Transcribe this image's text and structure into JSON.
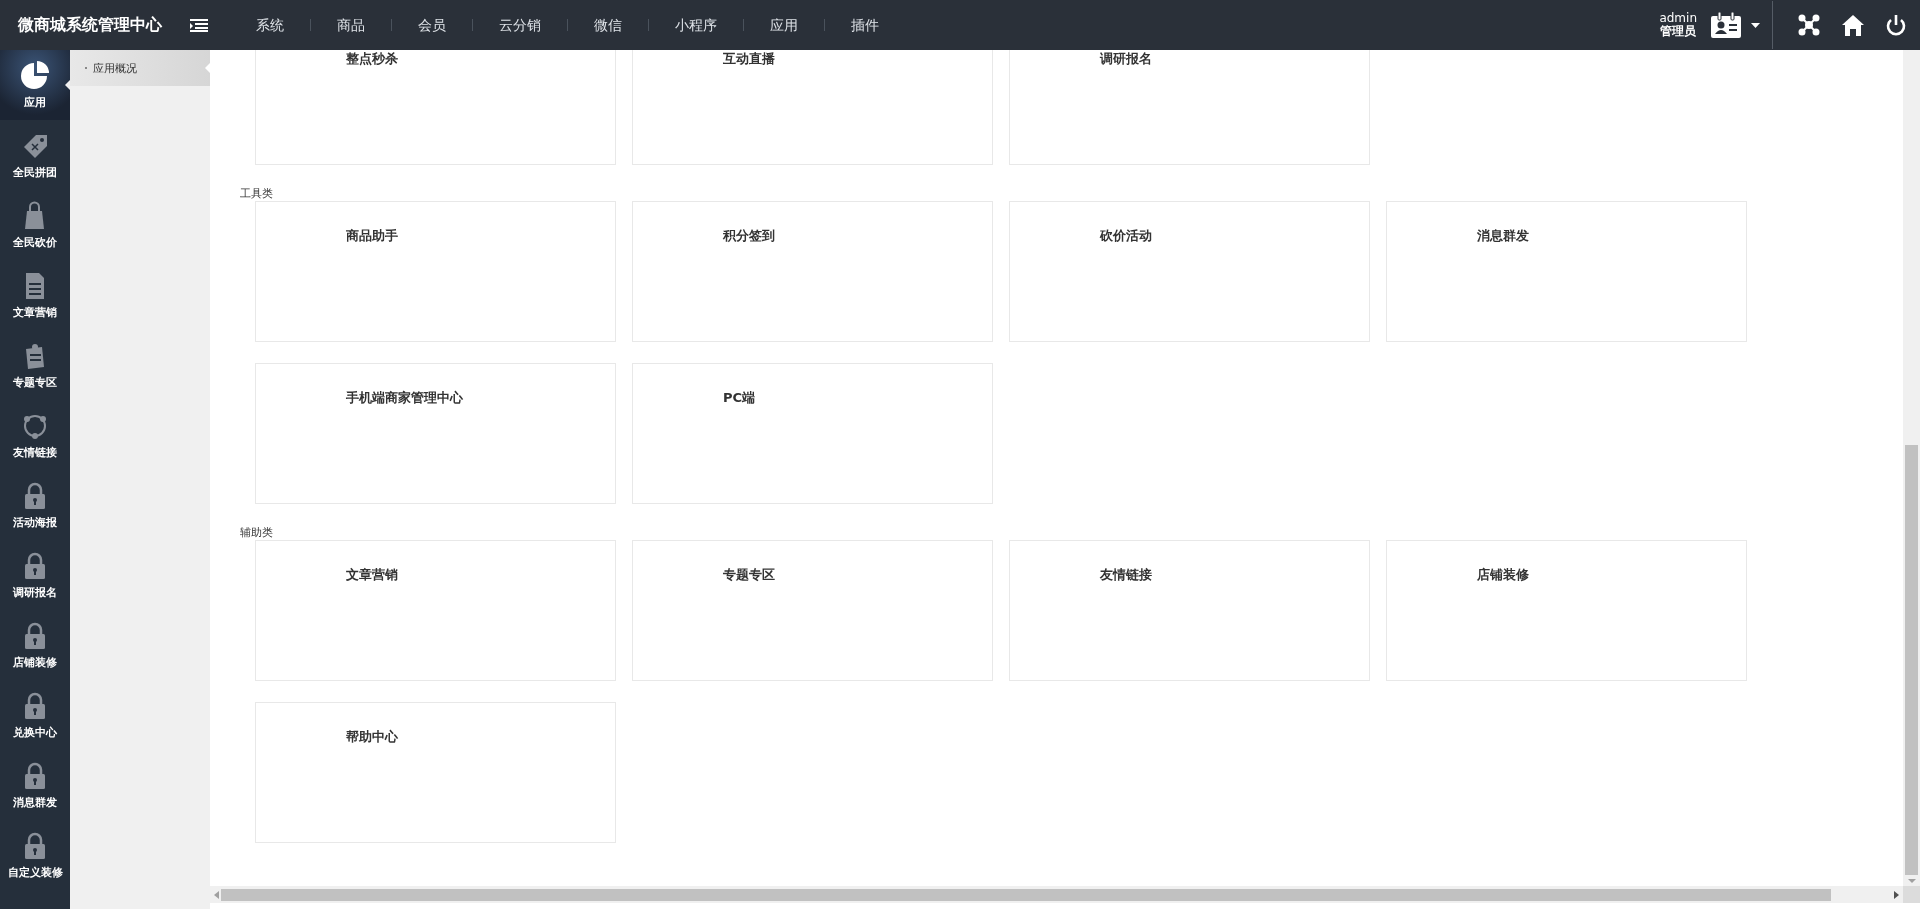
{
  "header": {
    "title": "微商城系统管理中心",
    "nav": [
      {
        "label": "系统"
      },
      {
        "label": "商品"
      },
      {
        "label": "会员"
      },
      {
        "label": "云分销"
      },
      {
        "label": "微信"
      },
      {
        "label": "小程序"
      },
      {
        "label": "应用"
      },
      {
        "label": "插件"
      }
    ],
    "user": {
      "name": "admin",
      "role": "管理员"
    }
  },
  "sidebar": {
    "items": [
      {
        "label": "应用",
        "kind": "pie",
        "selected": true
      },
      {
        "label": "全民拼团",
        "kind": "tag",
        "selected": false
      },
      {
        "label": "全民砍价",
        "kind": "bag",
        "selected": false
      },
      {
        "label": "文章营销",
        "kind": "doc",
        "selected": false
      },
      {
        "label": "专题专区",
        "kind": "note",
        "selected": false
      },
      {
        "label": "友情链接",
        "kind": "ring",
        "selected": false
      },
      {
        "label": "活动海报",
        "kind": "lock",
        "selected": false
      },
      {
        "label": "调研报名",
        "kind": "lock",
        "selected": false
      },
      {
        "label": "店铺装修",
        "kind": "lock",
        "selected": false
      },
      {
        "label": "兑换中心",
        "kind": "lock",
        "selected": false
      },
      {
        "label": "消息群发",
        "kind": "lock",
        "selected": false
      },
      {
        "label": "自定义装修",
        "kind": "lock",
        "selected": false
      }
    ]
  },
  "submenu": {
    "items": [
      {
        "label": "应用概况",
        "selected": true
      }
    ]
  },
  "groups": [
    {
      "cards": [
        {
          "title": "整点秒杀"
        },
        {
          "title": "互动直播"
        },
        {
          "title": "调研报名"
        }
      ]
    },
    {
      "heading": "工具类",
      "cards": [
        {
          "title": "商品助手"
        },
        {
          "title": "积分签到"
        },
        {
          "title": "砍价活动"
        },
        {
          "title": "消息群发"
        },
        {
          "title": "手机端商家管理中心"
        },
        {
          "title": "PC端"
        }
      ]
    },
    {
      "heading": "辅助类",
      "cards": [
        {
          "title": "文章营销"
        },
        {
          "title": "专题专区"
        },
        {
          "title": "友情链接"
        },
        {
          "title": "店铺装修"
        },
        {
          "title": "帮助中心"
        }
      ]
    }
  ]
}
